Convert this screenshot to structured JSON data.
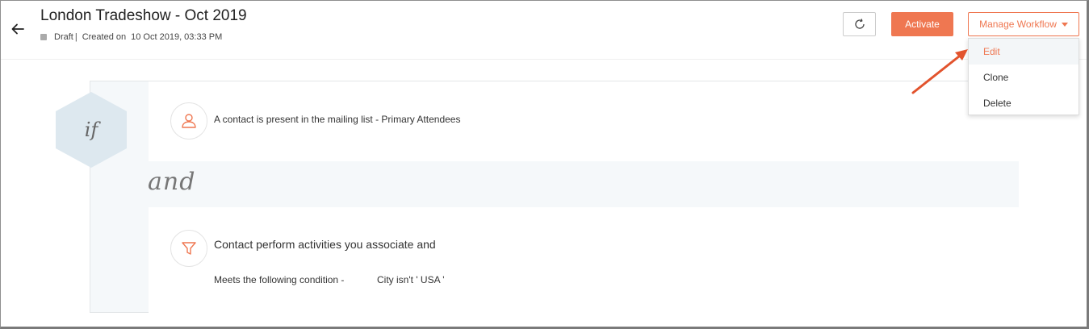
{
  "header": {
    "title": "London Tradeshow - Oct 2019",
    "status": "Draft",
    "separator": "|",
    "created_label": "Created on",
    "created_date": "10 Oct 2019, 03:33 PM"
  },
  "toolbar": {
    "activate_label": "Activate",
    "manage_label": "Manage Workflow"
  },
  "dropdown": {
    "items": [
      {
        "label": "Edit",
        "active": true
      },
      {
        "label": "Clone",
        "active": false
      },
      {
        "label": "Delete",
        "active": false
      }
    ]
  },
  "workflow": {
    "if_label": "if",
    "and_label": "and",
    "condition1": {
      "icon": "user-icon",
      "text": "A contact is present in the mailing list - Primary Attendees"
    },
    "condition2": {
      "icon": "filter-icon",
      "title": "Contact perform activities you associate and",
      "condition_label": "Meets the following condition -",
      "condition_value": "City isn't ' USA '"
    }
  },
  "colors": {
    "accent": "#ef7751",
    "hexagon": "#dde8ef",
    "panel": "#f5f8fa"
  }
}
